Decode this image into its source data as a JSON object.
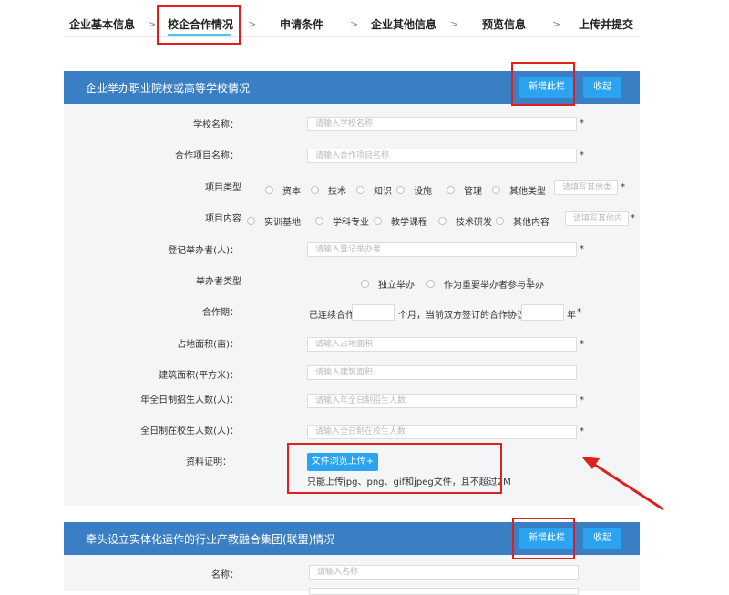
{
  "steps": [
    {
      "label": "企业基本信息"
    },
    {
      "label": "校企合作情况"
    },
    {
      "label": "申请条件"
    },
    {
      "label": "企业其他信息"
    },
    {
      "label": "预览信息"
    },
    {
      "label": "上传并提交"
    }
  ],
  "step_separator": ">",
  "section1": {
    "title": "企业举办职业院校或高等学校情况",
    "add_button": "新增此栏",
    "fold_button": "收起",
    "fields": {
      "school_name": {
        "label": "学校名称：",
        "placeholder": "请输入学校名称"
      },
      "project_name": {
        "label": "合作项目名称：",
        "placeholder": "请输入合作项目名称"
      },
      "project_type": {
        "label": "项目类型",
        "options": [
          "资本",
          "技术",
          "知识",
          "设施",
          "管理",
          "其他类型"
        ],
        "other_placeholder": "请填写其他类"
      },
      "project_content": {
        "label": "项目内容",
        "options": [
          "实训基地",
          "学科专业",
          "教学课程",
          "技术研发",
          "其他内容"
        ],
        "other_placeholder": "请填写其他内"
      },
      "organizer": {
        "label": "登记举办者(人)：",
        "placeholder": "请输入登记举办者"
      },
      "organizer_type": {
        "label": "举办者类型",
        "options": [
          "独立举办",
          "作为重要举办者参与举办"
        ]
      },
      "cooperation_period": {
        "label": "合作期：",
        "prefix": "已连续合作",
        "middle": "个月，当前双方签订的合作协议至",
        "suffix": "年"
      },
      "land_area": {
        "label": "占地面积(亩)：",
        "placeholder": "请输入占地面积"
      },
      "building_area": {
        "label": "建筑面积(平方米)：",
        "placeholder": "请输入建筑面积"
      },
      "annual_enrollment": {
        "label": "年全日制招生人数(人)：",
        "placeholder": "请输入年全日制招生人数"
      },
      "current_students": {
        "label": "全日制在校生人数(人)：",
        "placeholder": "请输入全日制在校生人数"
      },
      "documents": {
        "label": "资料证明：",
        "upload_button": "文件浏览上传+",
        "hint": "只能上传jpg、png、gif和jpeg文件，且不超过2M"
      }
    },
    "required_mark": "*"
  },
  "section2": {
    "title": "牵头设立实体化运作的行业产教融合集团(联盟)情况",
    "add_button": "新增此栏",
    "fold_button": "收起",
    "fields": {
      "name": {
        "label": "名称：",
        "placeholder": "请输入名称"
      }
    }
  },
  "colors": {
    "header_blue": "#3a7fc4",
    "button_blue": "#2aa3f0",
    "highlight_red": "#e0201c",
    "panel_bg": "#f4f5f7"
  }
}
